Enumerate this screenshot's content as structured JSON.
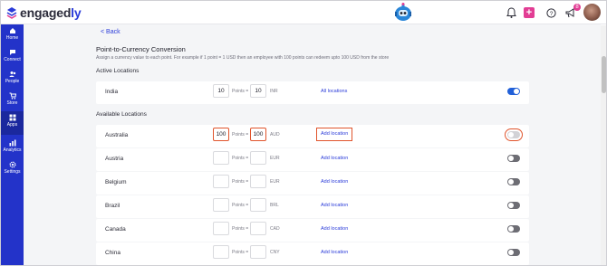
{
  "app": {
    "brand": "engaged",
    "brand_accent": "ly"
  },
  "topbar": {
    "notification_count": "8"
  },
  "sidebar": {
    "items": [
      {
        "label": "Home",
        "icon": "home-icon"
      },
      {
        "label": "Connect",
        "icon": "connect-icon"
      },
      {
        "label": "People",
        "icon": "people-icon"
      },
      {
        "label": "Store",
        "icon": "cart-icon"
      },
      {
        "label": "Apps",
        "icon": "apps-icon"
      },
      {
        "label": "Analytics",
        "icon": "analytics-icon"
      },
      {
        "label": "Settings",
        "icon": "settings-icon"
      }
    ],
    "active": "Apps"
  },
  "page": {
    "back_label": "Back",
    "title": "Point-to-Currency Conversion",
    "subtitle": "Assign a currency value to each point. For example if 1 point = 1 USD then an employee with 100 points can redeem upto 100 USD from the store",
    "active_heading": "Active Locations",
    "available_heading": "Available Locations",
    "points_equals": "Points =",
    "active_locations": [
      {
        "country": "India",
        "points": "10",
        "currency_value": "10",
        "currency": "INR",
        "action": "All locations",
        "enabled": true
      }
    ],
    "available_locations": [
      {
        "country": "Australia",
        "points": "100",
        "currency_value": "100",
        "currency": "AUD",
        "action": "Add location",
        "enabled": false,
        "highlighted": true
      },
      {
        "country": "Austria",
        "points": "",
        "currency_value": "",
        "currency": "EUR",
        "action": "Add location",
        "enabled": false
      },
      {
        "country": "Belgium",
        "points": "",
        "currency_value": "",
        "currency": "EUR",
        "action": "Add location",
        "enabled": false
      },
      {
        "country": "Brazil",
        "points": "",
        "currency_value": "",
        "currency": "BRL",
        "action": "Add location",
        "enabled": false
      },
      {
        "country": "Canada",
        "points": "",
        "currency_value": "",
        "currency": "CAD",
        "action": "Add location",
        "enabled": false
      },
      {
        "country": "China",
        "points": "",
        "currency_value": "",
        "currency": "CNY",
        "action": "Add location",
        "enabled": false
      }
    ]
  },
  "colors": {
    "brand": "#2333c9",
    "link": "#2a3bd9",
    "highlight": "#e0542c",
    "toggle_on": "#2160d8",
    "toggle_off": "#6d6d74",
    "accent_pink": "#e23d94"
  }
}
